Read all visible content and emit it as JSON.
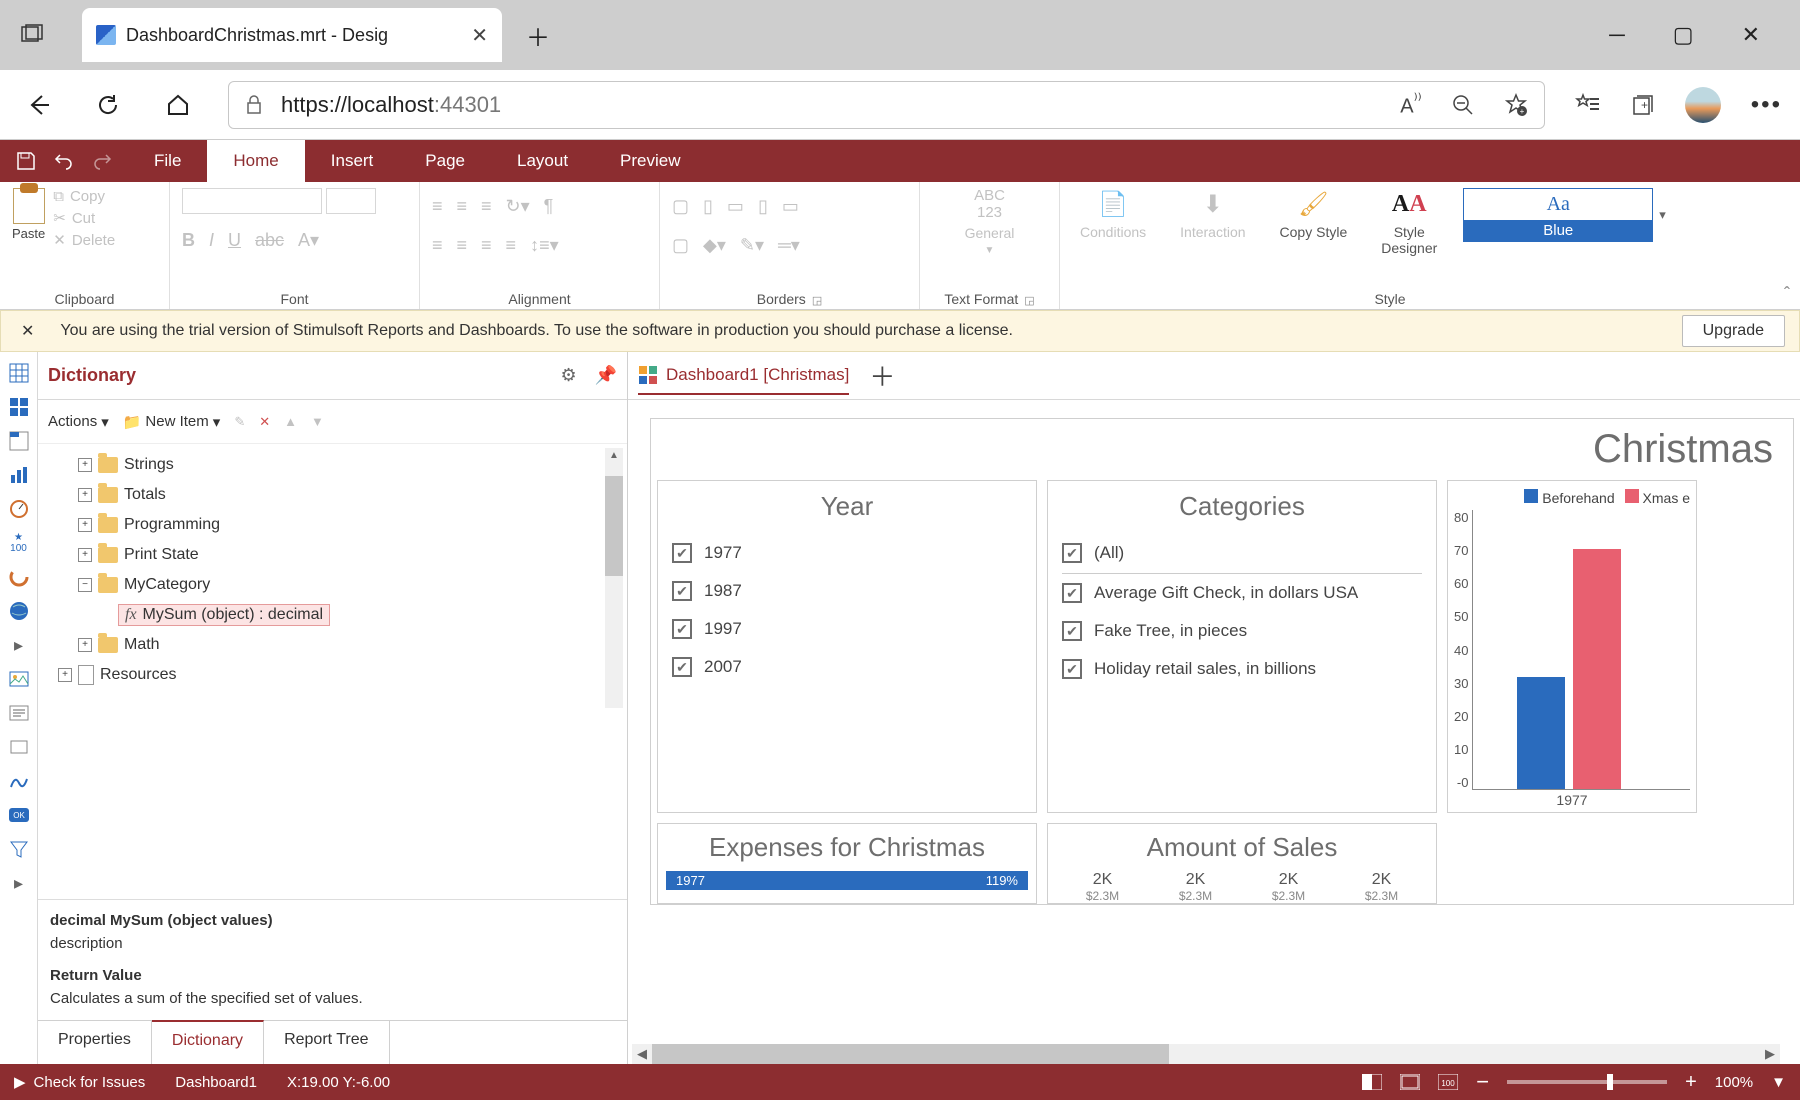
{
  "browser": {
    "tab_title": "DashboardChristmas.mrt - Desig",
    "url_host": "https://localhost",
    "url_port": ":44301"
  },
  "ribbon": {
    "tabs": {
      "file": "File",
      "home": "Home",
      "insert": "Insert",
      "page": "Page",
      "layout": "Layout",
      "preview": "Preview"
    },
    "clipboard": {
      "paste": "Paste",
      "copy": "Copy",
      "cut": "Cut",
      "delete": "Delete",
      "label": "Clipboard"
    },
    "font": {
      "label": "Font"
    },
    "alignment": {
      "label": "Alignment"
    },
    "borders": {
      "label": "Borders"
    },
    "textformat": {
      "general": "General",
      "label": "Text Format",
      "abc123": "ABC\n123"
    },
    "conditions": "Conditions",
    "interaction": "Interaction",
    "copystyle": "Copy Style",
    "styledesigner": "Style\nDesigner",
    "style_swatch_top": "Aa",
    "style_swatch_bot": "Blue",
    "style_label": "Style"
  },
  "trial": {
    "message": "You are using the trial version of Stimulsoft Reports and Dashboards. To use the software in production you should purchase a license.",
    "upgrade": "Upgrade"
  },
  "dictionary": {
    "title": "Dictionary",
    "actions": "Actions",
    "new_item": "New Item",
    "tree": {
      "strings": "Strings",
      "totals": "Totals",
      "programming": "Programming",
      "printstate": "Print State",
      "mycategory": "MyCategory",
      "mysum": "MySum (object) : decimal",
      "math": "Math",
      "resources": "Resources"
    },
    "desc": {
      "sig": "decimal MySum (object values)",
      "desc_label": "description",
      "return_label": "Return Value",
      "return_text": "Calculates a sum of the specified set of values."
    },
    "tabs": {
      "properties": "Properties",
      "dictionary": "Dictionary",
      "reporttree": "Report Tree"
    }
  },
  "canvas": {
    "tab": "Dashboard1 [Christmas]",
    "dashboard": {
      "title": "Christmas",
      "year": {
        "title": "Year",
        "items": [
          "1977",
          "1987",
          "1997",
          "2007"
        ]
      },
      "categories": {
        "title": "Categories",
        "all": "(All)",
        "items": [
          "Average Gift Check, in dollars USA",
          "Fake Tree, in pieces",
          "Holiday retail sales, in billions"
        ]
      },
      "chart": {
        "legend": {
          "beforehand": "Beforehand",
          "xmas": "Xmas e"
        },
        "yticks": [
          "80",
          "70",
          "60",
          "50",
          "40",
          "30",
          "20",
          "10",
          "-0"
        ],
        "xlabel": "1977"
      },
      "expenses": {
        "title": "Expenses for Christmas",
        "bar_left": "1977",
        "bar_right": "119%"
      },
      "sales": {
        "title": "Amount of Sales",
        "row1": [
          "2K",
          "2K",
          "2K",
          "2K"
        ],
        "row2": [
          "$2.3M",
          "$2.3M",
          "$2.3M",
          "$2.3M"
        ]
      }
    }
  },
  "status": {
    "check": "Check for Issues",
    "dashboard": "Dashboard1",
    "coords": "X:19.00 Y:-6.00",
    "zoom": "100%"
  },
  "chart_data": {
    "type": "bar",
    "categories": [
      "1977"
    ],
    "series": [
      {
        "name": "Beforehand",
        "values": [
          32
        ],
        "color": "#2a6bbd"
      },
      {
        "name": "Xmas e",
        "values": [
          68
        ],
        "color": "#e86070"
      }
    ],
    "ylim": [
      0,
      80
    ],
    "yticks": [
      0,
      10,
      20,
      30,
      40,
      50,
      60,
      70,
      80
    ]
  }
}
